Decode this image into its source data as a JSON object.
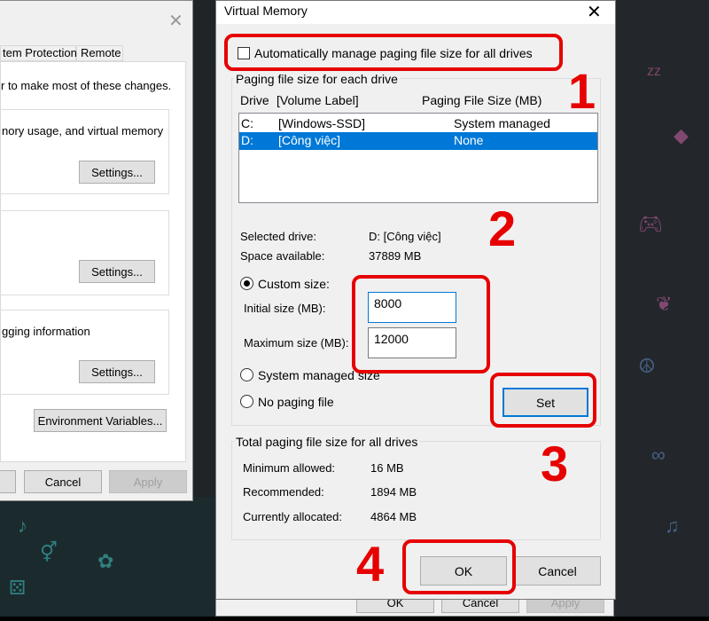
{
  "system_properties": {
    "tabs": [
      "tem Protection",
      "Remote"
    ],
    "admin_note": "r to make most of these changes.",
    "performance_desc": "nory usage, and virtual memory",
    "settings_1": "Settings...",
    "settings_2": "Settings...",
    "startup_desc": "gging information",
    "settings_3": "Settings...",
    "env_vars": "Environment Variables...",
    "cancel": "Cancel",
    "apply": "Apply"
  },
  "performance_options": {
    "ok": "OK",
    "cancel": "Cancel",
    "apply": "Apply"
  },
  "virtual_memory": {
    "title": "Virtual Memory",
    "auto_manage_label": "Automatically manage paging file size for all drives",
    "auto_manage_checked": false,
    "group_each_drive": "Paging file size for each drive",
    "columns": {
      "drive": "Drive",
      "volume": "[Volume Label]",
      "size": "Paging File Size (MB)"
    },
    "drives": [
      {
        "drive": "C:",
        "label": "[Windows-SSD]",
        "size": "System managed",
        "selected": false
      },
      {
        "drive": "D:",
        "label": "[Công việc]",
        "size": "None",
        "selected": true
      }
    ],
    "selected_drive_label": "Selected drive:",
    "selected_drive_value": "D:  [Công việc]",
    "space_label": "Space available:",
    "space_value": "37889 MB",
    "custom_size": "Custom size:",
    "initial_label": "Initial size (MB):",
    "initial_value": "8000",
    "max_label": "Maximum size (MB):",
    "max_value": "12000",
    "system_managed": "System managed size",
    "no_paging": "No paging file",
    "selected_option": "custom",
    "set": "Set",
    "group_total": "Total paging file size for all drives",
    "min_label": "Minimum allowed:",
    "min_value": "16 MB",
    "rec_label": "Recommended:",
    "rec_value": "1894 MB",
    "cur_label": "Currently allocated:",
    "cur_value": "4864 MB",
    "ok": "OK",
    "cancel": "Cancel"
  },
  "annotations": {
    "step1": "1",
    "step2": "2",
    "step3": "3",
    "step4": "4",
    "color": "#e60000"
  },
  "selection_color": "#0078d7"
}
